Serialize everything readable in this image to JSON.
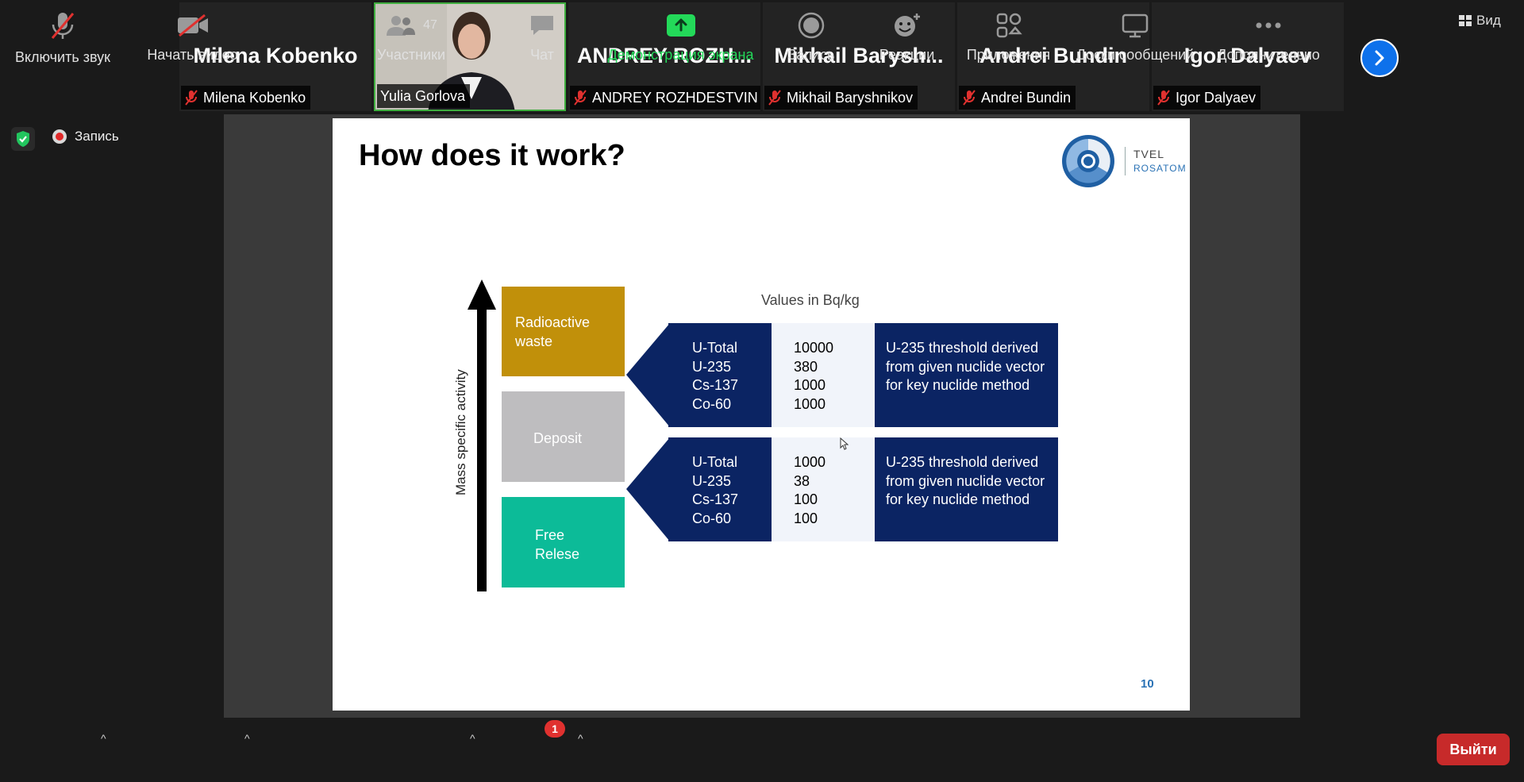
{
  "participants": [
    {
      "display_name": "Milena Kobenko",
      "tag": "Milena Kobenko",
      "muted": true
    },
    {
      "display_name": "",
      "tag": "Yulia Gorlova",
      "muted": false,
      "video": true
    },
    {
      "display_name": "ANDREY  ROZH...",
      "tag": "ANDREY ROZHDESTVIN",
      "muted": true
    },
    {
      "display_name": "Mikhail  Barysh...",
      "tag": "Mikhail Baryshnikov",
      "muted": true
    },
    {
      "display_name": "Andrei Bundin",
      "tag": "Andrei Bundin",
      "muted": true
    },
    {
      "display_name": "Igor Dalyaev",
      "tag": "Igor Dalyaev",
      "muted": true
    }
  ],
  "header": {
    "view_label": "Вид",
    "recording_label": "Запись"
  },
  "slide": {
    "title": "How does it work?",
    "logo": {
      "line1": "TVEL",
      "line2": "ROSATOM"
    },
    "axis_label": "Mass specific activity",
    "categories": [
      {
        "label": "Radioactive waste",
        "color": "#c1900a"
      },
      {
        "label": "Deposit",
        "color": "#bebdbf"
      },
      {
        "label": "Free Relese",
        "color": "#0cbb98"
      }
    ],
    "values_header": "Values in Bq/kg",
    "panels": [
      {
        "nuclides": [
          "U-Total",
          "U-235",
          "Cs-137",
          "Co-60"
        ],
        "values": [
          "10000",
          "380",
          "1000",
          "1000"
        ],
        "note": "U-235 threshold derived from given nuclide vector for key nuclide method"
      },
      {
        "nuclides": [
          "U-Total",
          "U-235",
          "Cs-137",
          "Co-60"
        ],
        "values": [
          "1000",
          "38",
          "100",
          "100"
        ],
        "note": "U-235 threshold derived from given nuclide vector for key nuclide method"
      }
    ],
    "page_number": "10"
  },
  "toolbar": {
    "unmute": "Включить звук",
    "start_video": "Начать видео",
    "participants": "Участники",
    "participants_count": "47",
    "chat": "Чат",
    "chat_badge": "1",
    "share_screen": "Демонстрация экрана",
    "record": "Запись",
    "reactions": "Реакции",
    "apps": "Приложения",
    "whiteboards": "Доски сообщений",
    "more": "Дополнительно",
    "leave": "Выйти"
  },
  "colors": {
    "accent_blue": "#0e71eb",
    "share_green": "#23d959",
    "navy": "#0b2463",
    "leave_red": "#c72a2a"
  }
}
